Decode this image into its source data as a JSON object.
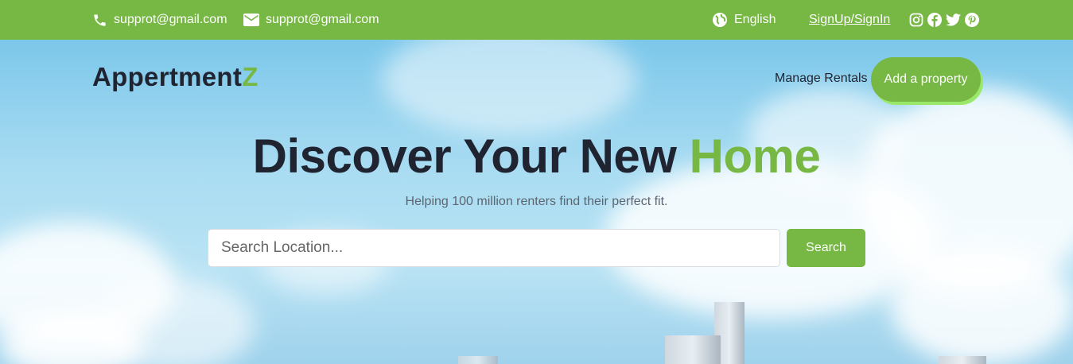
{
  "topbar": {
    "phone_email": "supprot@gmail.com",
    "mail_email": "supprot@gmail.com",
    "language": "English",
    "auth_link": "SignUp/SignIn",
    "icons": [
      "phone-icon",
      "mail-icon",
      "globe-icon",
      "instagram-icon",
      "facebook-icon",
      "twitter-icon",
      "pinterest-icon"
    ]
  },
  "header": {
    "logo_main": "Appertment",
    "logo_accent": "Z",
    "manage_rentals": "Manage Rentals",
    "add_property": "Add a property"
  },
  "hero": {
    "headline_main": "Discover Your New",
    "headline_accent": "Home",
    "subtitle": "Helping 100 million renters find their perfect fit."
  },
  "search": {
    "placeholder": "Search Location...",
    "button": "Search"
  },
  "colors": {
    "accent": "#76b843",
    "text_dark": "#1f2430",
    "sky": "#a9dcf2"
  }
}
